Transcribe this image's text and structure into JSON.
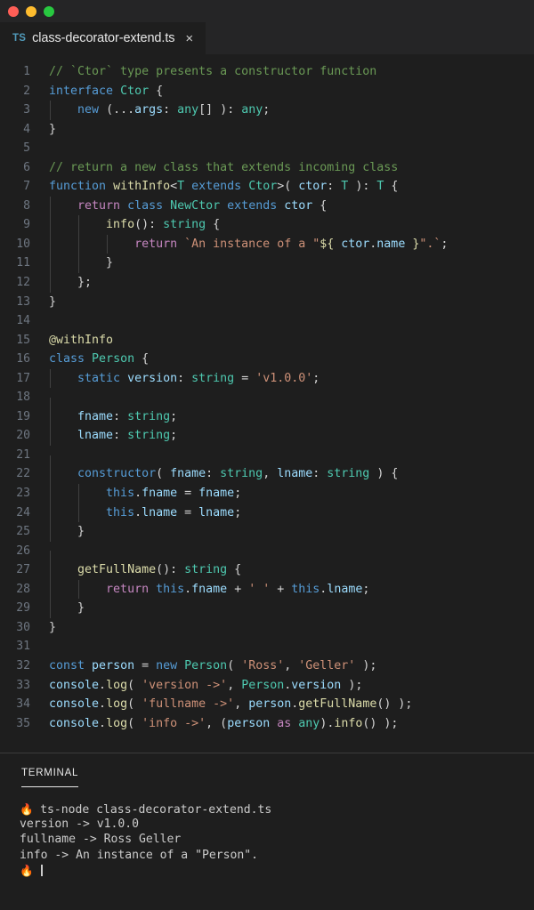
{
  "window": {
    "traffic_lights": [
      {
        "name": "close",
        "color": "#ff5f57"
      },
      {
        "name": "minimize",
        "color": "#febc2e"
      },
      {
        "name": "maximize",
        "color": "#28c840"
      }
    ]
  },
  "tab": {
    "icon_label": "TS",
    "filename": "class-decorator-extend.ts",
    "close_label": "×"
  },
  "editor": {
    "theme": {
      "background": "#1e1e1e",
      "tabbar_background": "#252526",
      "line_number": "#6e7681",
      "foreground": "#d4d4d4",
      "comment": "#6a9955",
      "keyword": "#569cd6",
      "control": "#c586c0",
      "type": "#4ec9b0",
      "function": "#dcdcaa",
      "variable": "#9cdcfe",
      "string": "#ce9178",
      "indent_guide": "#404040"
    },
    "lines": [
      {
        "n": 1,
        "indent": 0,
        "tokens": [
          {
            "t": "// `Ctor` type presents a constructor function",
            "c": "com"
          }
        ]
      },
      {
        "n": 2,
        "indent": 0,
        "tokens": [
          {
            "t": "interface ",
            "c": "key"
          },
          {
            "t": "Ctor ",
            "c": "type"
          },
          {
            "t": "{",
            "c": "pln"
          }
        ]
      },
      {
        "n": 3,
        "indent": 1,
        "tokens": [
          {
            "t": "    ",
            "c": "pln"
          },
          {
            "t": "new",
            "c": "key"
          },
          {
            "t": " (...",
            "c": "pln"
          },
          {
            "t": "args",
            "c": "var"
          },
          {
            "t": ": ",
            "c": "pln"
          },
          {
            "t": "any",
            "c": "type"
          },
          {
            "t": "[] ): ",
            "c": "pln"
          },
          {
            "t": "any",
            "c": "type"
          },
          {
            "t": ";",
            "c": "pln"
          }
        ]
      },
      {
        "n": 4,
        "indent": 0,
        "tokens": [
          {
            "t": "}",
            "c": "pln"
          }
        ]
      },
      {
        "n": 5,
        "indent": 0,
        "tokens": []
      },
      {
        "n": 6,
        "indent": 0,
        "tokens": [
          {
            "t": "// return a new class that extends incoming class",
            "c": "com"
          }
        ]
      },
      {
        "n": 7,
        "indent": 0,
        "tokens": [
          {
            "t": "function ",
            "c": "key"
          },
          {
            "t": "withInfo",
            "c": "fn"
          },
          {
            "t": "<",
            "c": "pln"
          },
          {
            "t": "T ",
            "c": "type"
          },
          {
            "t": "extends ",
            "c": "key"
          },
          {
            "t": "Ctor",
            "c": "type"
          },
          {
            "t": ">( ",
            "c": "pln"
          },
          {
            "t": "ctor",
            "c": "var"
          },
          {
            "t": ": ",
            "c": "pln"
          },
          {
            "t": "T ",
            "c": "type"
          },
          {
            "t": "): ",
            "c": "pln"
          },
          {
            "t": "T ",
            "c": "type"
          },
          {
            "t": "{",
            "c": "pln"
          }
        ]
      },
      {
        "n": 8,
        "indent": 1,
        "tokens": [
          {
            "t": "    ",
            "c": "pln"
          },
          {
            "t": "return ",
            "c": "ctl"
          },
          {
            "t": "class ",
            "c": "key"
          },
          {
            "t": "NewCtor ",
            "c": "type"
          },
          {
            "t": "extends ",
            "c": "key"
          },
          {
            "t": "ctor",
            "c": "var"
          },
          {
            "t": " {",
            "c": "pln"
          }
        ]
      },
      {
        "n": 9,
        "indent": 2,
        "tokens": [
          {
            "t": "        ",
            "c": "pln"
          },
          {
            "t": "info",
            "c": "fn"
          },
          {
            "t": "(): ",
            "c": "pln"
          },
          {
            "t": "string ",
            "c": "type"
          },
          {
            "t": "{",
            "c": "pln"
          }
        ]
      },
      {
        "n": 10,
        "indent": 3,
        "tokens": [
          {
            "t": "            ",
            "c": "pln"
          },
          {
            "t": "return ",
            "c": "ctl"
          },
          {
            "t": "`An instance of a \"",
            "c": "str"
          },
          {
            "t": "${",
            "c": "fn"
          },
          {
            "t": " ctor",
            "c": "var"
          },
          {
            "t": ".",
            "c": "pln"
          },
          {
            "t": "name ",
            "c": "var"
          },
          {
            "t": "}",
            "c": "fn"
          },
          {
            "t": "\".`",
            "c": "str"
          },
          {
            "t": ";",
            "c": "pln"
          }
        ]
      },
      {
        "n": 11,
        "indent": 2,
        "tokens": [
          {
            "t": "        }",
            "c": "pln"
          }
        ]
      },
      {
        "n": 12,
        "indent": 1,
        "tokens": [
          {
            "t": "    };",
            "c": "pln"
          }
        ]
      },
      {
        "n": 13,
        "indent": 0,
        "tokens": [
          {
            "t": "}",
            "c": "pln"
          }
        ]
      },
      {
        "n": 14,
        "indent": 0,
        "tokens": []
      },
      {
        "n": 15,
        "indent": 0,
        "tokens": [
          {
            "t": "@withInfo",
            "c": "fn"
          }
        ]
      },
      {
        "n": 16,
        "indent": 0,
        "tokens": [
          {
            "t": "class ",
            "c": "key"
          },
          {
            "t": "Person ",
            "c": "type"
          },
          {
            "t": "{",
            "c": "pln"
          }
        ]
      },
      {
        "n": 17,
        "indent": 1,
        "tokens": [
          {
            "t": "    ",
            "c": "pln"
          },
          {
            "t": "static ",
            "c": "key"
          },
          {
            "t": "version",
            "c": "var"
          },
          {
            "t": ": ",
            "c": "pln"
          },
          {
            "t": "string ",
            "c": "type"
          },
          {
            "t": "= ",
            "c": "pln"
          },
          {
            "t": "'v1.0.0'",
            "c": "str"
          },
          {
            "t": ";",
            "c": "pln"
          }
        ]
      },
      {
        "n": 18,
        "indent": 1,
        "tokens": []
      },
      {
        "n": 19,
        "indent": 1,
        "tokens": [
          {
            "t": "    ",
            "c": "pln"
          },
          {
            "t": "fname",
            "c": "var"
          },
          {
            "t": ": ",
            "c": "pln"
          },
          {
            "t": "string",
            "c": "type"
          },
          {
            "t": ";",
            "c": "pln"
          }
        ]
      },
      {
        "n": 20,
        "indent": 1,
        "tokens": [
          {
            "t": "    ",
            "c": "pln"
          },
          {
            "t": "lname",
            "c": "var"
          },
          {
            "t": ": ",
            "c": "pln"
          },
          {
            "t": "string",
            "c": "type"
          },
          {
            "t": ";",
            "c": "pln"
          }
        ]
      },
      {
        "n": 21,
        "indent": 1,
        "tokens": []
      },
      {
        "n": 22,
        "indent": 1,
        "tokens": [
          {
            "t": "    ",
            "c": "pln"
          },
          {
            "t": "constructor",
            "c": "key"
          },
          {
            "t": "( ",
            "c": "pln"
          },
          {
            "t": "fname",
            "c": "var"
          },
          {
            "t": ": ",
            "c": "pln"
          },
          {
            "t": "string",
            "c": "type"
          },
          {
            "t": ", ",
            "c": "pln"
          },
          {
            "t": "lname",
            "c": "var"
          },
          {
            "t": ": ",
            "c": "pln"
          },
          {
            "t": "string ",
            "c": "type"
          },
          {
            "t": ") {",
            "c": "pln"
          }
        ]
      },
      {
        "n": 23,
        "indent": 2,
        "tokens": [
          {
            "t": "        ",
            "c": "pln"
          },
          {
            "t": "this",
            "c": "key"
          },
          {
            "t": ".",
            "c": "pln"
          },
          {
            "t": "fname ",
            "c": "var"
          },
          {
            "t": "= ",
            "c": "pln"
          },
          {
            "t": "fname",
            "c": "var"
          },
          {
            "t": ";",
            "c": "pln"
          }
        ]
      },
      {
        "n": 24,
        "indent": 2,
        "tokens": [
          {
            "t": "        ",
            "c": "pln"
          },
          {
            "t": "this",
            "c": "key"
          },
          {
            "t": ".",
            "c": "pln"
          },
          {
            "t": "lname ",
            "c": "var"
          },
          {
            "t": "= ",
            "c": "pln"
          },
          {
            "t": "lname",
            "c": "var"
          },
          {
            "t": ";",
            "c": "pln"
          }
        ]
      },
      {
        "n": 25,
        "indent": 1,
        "tokens": [
          {
            "t": "    }",
            "c": "pln"
          }
        ]
      },
      {
        "n": 26,
        "indent": 1,
        "tokens": []
      },
      {
        "n": 27,
        "indent": 1,
        "tokens": [
          {
            "t": "    ",
            "c": "pln"
          },
          {
            "t": "getFullName",
            "c": "fn"
          },
          {
            "t": "(): ",
            "c": "pln"
          },
          {
            "t": "string ",
            "c": "type"
          },
          {
            "t": "{",
            "c": "pln"
          }
        ]
      },
      {
        "n": 28,
        "indent": 2,
        "tokens": [
          {
            "t": "        ",
            "c": "pln"
          },
          {
            "t": "return ",
            "c": "ctl"
          },
          {
            "t": "this",
            "c": "key"
          },
          {
            "t": ".",
            "c": "pln"
          },
          {
            "t": "fname ",
            "c": "var"
          },
          {
            "t": "+ ",
            "c": "pln"
          },
          {
            "t": "' '",
            "c": "str"
          },
          {
            "t": " + ",
            "c": "pln"
          },
          {
            "t": "this",
            "c": "key"
          },
          {
            "t": ".",
            "c": "pln"
          },
          {
            "t": "lname",
            "c": "var"
          },
          {
            "t": ";",
            "c": "pln"
          }
        ]
      },
      {
        "n": 29,
        "indent": 1,
        "tokens": [
          {
            "t": "    }",
            "c": "pln"
          }
        ]
      },
      {
        "n": 30,
        "indent": 0,
        "tokens": [
          {
            "t": "}",
            "c": "pln"
          }
        ]
      },
      {
        "n": 31,
        "indent": 0,
        "tokens": []
      },
      {
        "n": 32,
        "indent": 0,
        "tokens": [
          {
            "t": "const ",
            "c": "key"
          },
          {
            "t": "person ",
            "c": "var"
          },
          {
            "t": "= ",
            "c": "pln"
          },
          {
            "t": "new ",
            "c": "key"
          },
          {
            "t": "Person",
            "c": "type"
          },
          {
            "t": "( ",
            "c": "pln"
          },
          {
            "t": "'Ross'",
            "c": "str"
          },
          {
            "t": ", ",
            "c": "pln"
          },
          {
            "t": "'Geller'",
            "c": "str"
          },
          {
            "t": " );",
            "c": "pln"
          }
        ]
      },
      {
        "n": 33,
        "indent": 0,
        "tokens": [
          {
            "t": "console",
            "c": "var"
          },
          {
            "t": ".",
            "c": "pln"
          },
          {
            "t": "log",
            "c": "fn"
          },
          {
            "t": "( ",
            "c": "pln"
          },
          {
            "t": "'version ->'",
            "c": "str"
          },
          {
            "t": ", ",
            "c": "pln"
          },
          {
            "t": "Person",
            "c": "type"
          },
          {
            "t": ".",
            "c": "pln"
          },
          {
            "t": "version",
            "c": "var"
          },
          {
            "t": " );",
            "c": "pln"
          }
        ]
      },
      {
        "n": 34,
        "indent": 0,
        "tokens": [
          {
            "t": "console",
            "c": "var"
          },
          {
            "t": ".",
            "c": "pln"
          },
          {
            "t": "log",
            "c": "fn"
          },
          {
            "t": "( ",
            "c": "pln"
          },
          {
            "t": "'fullname ->'",
            "c": "str"
          },
          {
            "t": ", ",
            "c": "pln"
          },
          {
            "t": "person",
            "c": "var"
          },
          {
            "t": ".",
            "c": "pln"
          },
          {
            "t": "getFullName",
            "c": "fn"
          },
          {
            "t": "() );",
            "c": "pln"
          }
        ]
      },
      {
        "n": 35,
        "indent": 0,
        "tokens": [
          {
            "t": "console",
            "c": "var"
          },
          {
            "t": ".",
            "c": "pln"
          },
          {
            "t": "log",
            "c": "fn"
          },
          {
            "t": "( ",
            "c": "pln"
          },
          {
            "t": "'info ->'",
            "c": "str"
          },
          {
            "t": ", (",
            "c": "pln"
          },
          {
            "t": "person ",
            "c": "var"
          },
          {
            "t": "as ",
            "c": "ctl"
          },
          {
            "t": "any",
            "c": "type"
          },
          {
            "t": ").",
            "c": "pln"
          },
          {
            "t": "info",
            "c": "fn"
          },
          {
            "t": "() );",
            "c": "pln"
          }
        ]
      }
    ]
  },
  "panel": {
    "tab_label": "TERMINAL",
    "terminal": {
      "prompt_glyph": "🔥",
      "lines": [
        {
          "prompt": true,
          "text": "ts-node class-decorator-extend.ts"
        },
        {
          "prompt": false,
          "text": "version -> v1.0.0"
        },
        {
          "prompt": false,
          "text": "fullname -> Ross Geller"
        },
        {
          "prompt": false,
          "text": "info -> An instance of a \"Person\"."
        }
      ],
      "current_prompt": ""
    }
  }
}
